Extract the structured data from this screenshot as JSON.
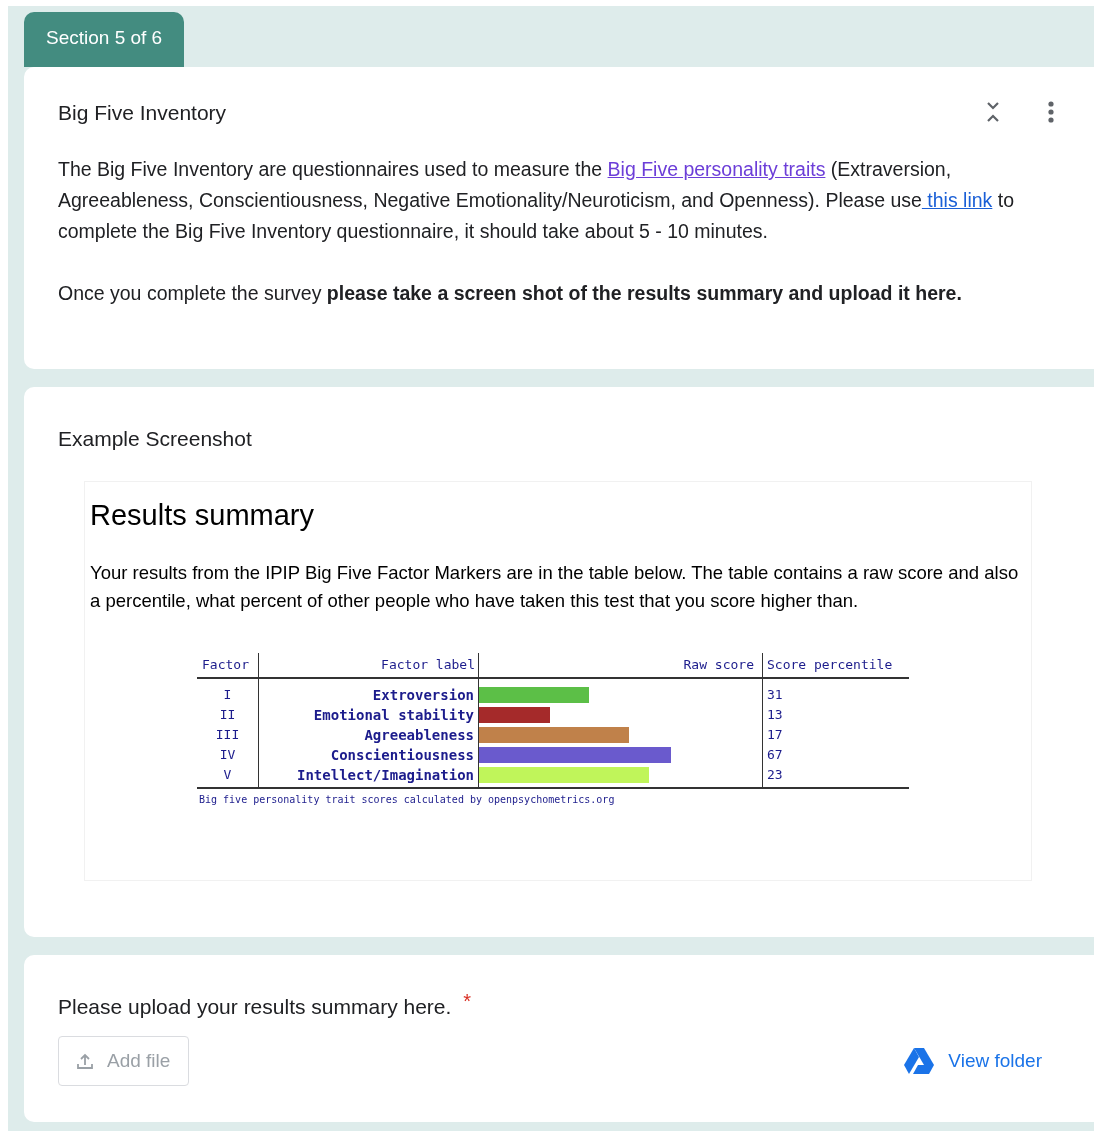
{
  "section_tab": "Section 5 of 6",
  "intro_card": {
    "title": "Big Five Inventory",
    "paragraph_parts": [
      "The Big Five Inventory are questionnaires used to measure the ",
      "Big Five personality traits",
      " (Extraversion, Agreeableness, Conscientiousness, Negative Emotionality/Neuroticism, and Openness). Please use",
      " this link",
      " to complete the Big Five Inventory questionnaire, it should take about 5 - 10 minutes."
    ],
    "instruction": "Once you complete the survey **please take a screen shot of the results summary and upload it here.**"
  },
  "example_card": {
    "title": "Example Screenshot",
    "screenshot": {
      "heading": "Results summary",
      "description": "Your results from the IPIP Big Five Factor Markers are in the table below. The table contains a raw score and also a percentile, what percent of other people who have taken this test that you score higher than.",
      "columns": [
        "Factor",
        "Factor label",
        "Raw score",
        "Score percentile"
      ],
      "rows": [
        {
          "factor": "I",
          "label": "Extroversion",
          "level": 0.39,
          "color": "#5cbf47",
          "percentile": "31"
        },
        {
          "factor": "II",
          "label": "Emotional stability",
          "level": 0.25,
          "color": "#a52a2a",
          "percentile": "13"
        },
        {
          "factor": "III",
          "label": "Agreeableness",
          "level": 0.53,
          "color": "#c0814a",
          "percentile": "17"
        },
        {
          "factor": "IV",
          "label": "Conscientiousness",
          "level": 0.68,
          "color": "#6a5acd",
          "percentile": "67"
        },
        {
          "factor": "V",
          "label": "Intellect/Imagination",
          "level": 0.6,
          "color": "#c0f55a",
          "percentile": "23"
        }
      ],
      "footnote": "Big five personality trait scores calculated by openpsychometrics.org"
    }
  },
  "upload_card": {
    "question": "Please upload your results summary here.",
    "required_mark": "*",
    "add_file_button": "Add file",
    "view_folder_link": "View folder"
  }
}
